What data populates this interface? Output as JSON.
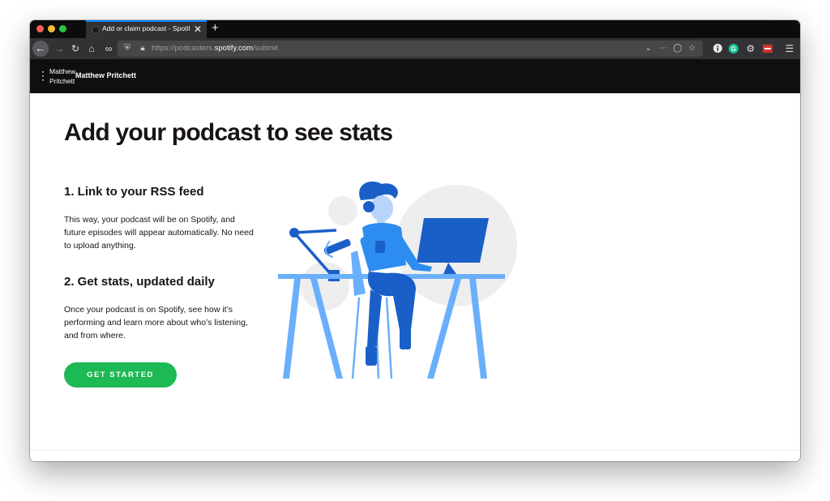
{
  "browser": {
    "tab_title": "Add or claim podcast - Spotify",
    "new_tab_label": "+",
    "close_tab_label": "✕",
    "url_prefix": "https://podcasters.",
    "url_host": "spotify.com",
    "url_path": "/submit"
  },
  "appbar": {
    "user_label_small": "Matthew Pritchett",
    "user_name": "Matthew Pritchett"
  },
  "main": {
    "title": "Add your podcast to see stats",
    "step1_title": "1. Link to your RSS feed",
    "step1_text": "This way, your podcast will be on Spotify, and future episodes will appear automatically. No need to upload anything.",
    "step2_title": "2. Get stats, updated daily",
    "step2_text": "Once your podcast is on Spotify, see how it’s performing and learn more about who’s listening, and from where.",
    "cta_label": "GET STARTED"
  },
  "colors": {
    "brand_green": "#1db954",
    "illustration_dark_blue": "#1a5fc8",
    "illustration_light_blue": "#6aaffb"
  },
  "icons": [
    "back-icon",
    "forward-icon",
    "reload-icon",
    "home-icon",
    "reader-icon",
    "shield-icon",
    "lock-icon",
    "dropdown-icon",
    "more-icon",
    "pocket-icon",
    "bookmark-star-icon",
    "info-icon",
    "grammarly-icon",
    "settings-icon",
    "extension-icon",
    "menu-icon",
    "kebab-icon"
  ]
}
